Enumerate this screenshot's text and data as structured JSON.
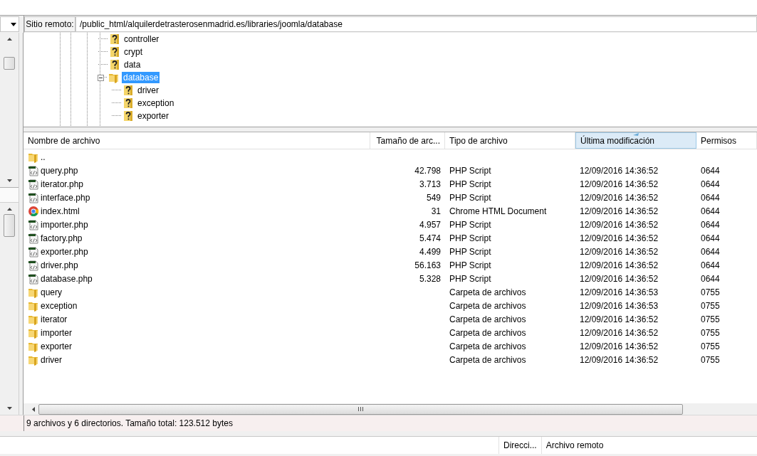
{
  "remote_site": {
    "label": "Sitio remoto:",
    "path": "/public_html/alquilerdetrasterosenmadrid.es/libraries/joomla/database"
  },
  "tree": [
    {
      "name": "controller",
      "kind": "unknown",
      "selected": false
    },
    {
      "name": "crypt",
      "kind": "unknown",
      "selected": false
    },
    {
      "name": "data",
      "kind": "unknown",
      "selected": false
    },
    {
      "name": "database",
      "kind": "folder",
      "selected": true,
      "expanded": true,
      "children": [
        {
          "name": "driver",
          "kind": "unknown",
          "selected": false
        },
        {
          "name": "exception",
          "kind": "unknown",
          "selected": false
        },
        {
          "name": "exporter",
          "kind": "unknown",
          "selected": false
        }
      ]
    }
  ],
  "file_list": {
    "columns": [
      {
        "label": "Nombre de archivo",
        "sorted": false
      },
      {
        "label": "Tamaño de arc...",
        "sorted": false
      },
      {
        "label": "Tipo de archivo",
        "sorted": false
      },
      {
        "label": "Última modificación",
        "sorted": true
      },
      {
        "label": "Permisos",
        "sorted": false
      }
    ],
    "rows": [
      {
        "kind": "folder",
        "name": ".."
      },
      {
        "kind": "php",
        "name": "query.php",
        "size": "42.798",
        "type": "PHP Script",
        "modified": "12/09/2016 14:36:52",
        "permissions": "0644"
      },
      {
        "kind": "php",
        "name": "iterator.php",
        "size": "3.713",
        "type": "PHP Script",
        "modified": "12/09/2016 14:36:52",
        "permissions": "0644"
      },
      {
        "kind": "php",
        "name": "interface.php",
        "size": "549",
        "type": "PHP Script",
        "modified": "12/09/2016 14:36:52",
        "permissions": "0644"
      },
      {
        "kind": "chrome",
        "name": "index.html",
        "size": "31",
        "type": "Chrome HTML Document",
        "modified": "12/09/2016 14:36:52",
        "permissions": "0644"
      },
      {
        "kind": "php",
        "name": "importer.php",
        "size": "4.957",
        "type": "PHP Script",
        "modified": "12/09/2016 14:36:52",
        "permissions": "0644"
      },
      {
        "kind": "php",
        "name": "factory.php",
        "size": "5.474",
        "type": "PHP Script",
        "modified": "12/09/2016 14:36:52",
        "permissions": "0644"
      },
      {
        "kind": "php",
        "name": "exporter.php",
        "size": "4.499",
        "type": "PHP Script",
        "modified": "12/09/2016 14:36:52",
        "permissions": "0644"
      },
      {
        "kind": "php",
        "name": "driver.php",
        "size": "56.163",
        "type": "PHP Script",
        "modified": "12/09/2016 14:36:52",
        "permissions": "0644"
      },
      {
        "kind": "php",
        "name": "database.php",
        "size": "5.328",
        "type": "PHP Script",
        "modified": "12/09/2016 14:36:52",
        "permissions": "0644"
      },
      {
        "kind": "folder",
        "name": "query",
        "type": "Carpeta de archivos",
        "modified": "12/09/2016 14:36:53",
        "permissions": "0755"
      },
      {
        "kind": "folder",
        "name": "exception",
        "type": "Carpeta de archivos",
        "modified": "12/09/2016 14:36:53",
        "permissions": "0755"
      },
      {
        "kind": "folder",
        "name": "iterator",
        "type": "Carpeta de archivos",
        "modified": "12/09/2016 14:36:52",
        "permissions": "0755"
      },
      {
        "kind": "folder",
        "name": "importer",
        "type": "Carpeta de archivos",
        "modified": "12/09/2016 14:36:52",
        "permissions": "0755"
      },
      {
        "kind": "folder",
        "name": "exporter",
        "type": "Carpeta de archivos",
        "modified": "12/09/2016 14:36:52",
        "permissions": "0755"
      },
      {
        "kind": "folder",
        "name": "driver",
        "type": "Carpeta de archivos",
        "modified": "12/09/2016 14:36:52",
        "permissions": "0755"
      }
    ]
  },
  "status_bar": "9 archivos y 6 directorios. Tamaño total: 123.512 bytes",
  "queue": {
    "columns": [
      "Direcci...",
      "Archivo remoto"
    ]
  }
}
